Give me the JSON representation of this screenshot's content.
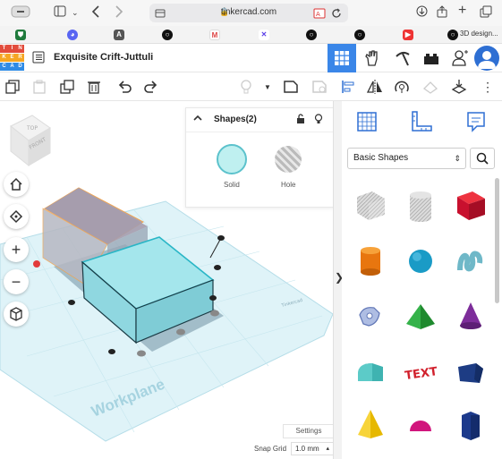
{
  "browser": {
    "url": "tinkercad.com",
    "bookmarks": [
      {
        "icon": "shield-icon"
      },
      {
        "icon": "discord-icon"
      },
      {
        "icon": "a-icon"
      },
      {
        "icon": "circle-icon"
      },
      {
        "icon": "gmail-icon"
      },
      {
        "icon": "x-icon"
      },
      {
        "icon": "circle-icon"
      },
      {
        "icon": "circle-icon"
      },
      {
        "icon": "youtube-icon"
      },
      {
        "icon": "circle-icon"
      }
    ],
    "last_bookmark_label": "3D design..."
  },
  "app": {
    "logo_letters": [
      "TIN",
      "KER",
      "CAD"
    ],
    "project_title": "Exquisite Crift-Juttuli",
    "colors": {
      "accent": "#3a86e8",
      "header_active": "#3a86e8",
      "solid": "#bff0f0",
      "solid_border": "#5cc2cc"
    }
  },
  "shapes_panel": {
    "title": "Shapes(2)",
    "solid_label": "Solid",
    "hole_label": "Hole"
  },
  "workspace": {
    "plane_label": "Workplane",
    "settings_label": "Settings",
    "snap_grid_label": "Snap Grid",
    "snap_grid_value": "1.0 mm",
    "viewcube": {
      "top": "TOP",
      "front": "FRONT"
    },
    "corner_note": "Tinkercad"
  },
  "library": {
    "selected_category": "Basic Shapes",
    "shapes": [
      {
        "name": "box-hole",
        "icon": "box-hole-icon"
      },
      {
        "name": "cylinder-hole",
        "icon": "cylinder-hole-icon"
      },
      {
        "name": "box",
        "icon": "box-icon"
      },
      {
        "name": "cylinder",
        "icon": "cylinder-icon"
      },
      {
        "name": "sphere",
        "icon": "sphere-icon"
      },
      {
        "name": "scribble",
        "icon": "scribble-icon"
      },
      {
        "name": "shape-generator",
        "icon": "shape-generator-icon"
      },
      {
        "name": "roof",
        "icon": "roof-icon"
      },
      {
        "name": "cone",
        "icon": "cone-icon"
      },
      {
        "name": "round-roof",
        "icon": "round-roof-icon"
      },
      {
        "name": "text",
        "icon": "text-icon",
        "text": "TEXT"
      },
      {
        "name": "polygon",
        "icon": "polygon-icon"
      },
      {
        "name": "pyramid",
        "icon": "pyramid-icon"
      },
      {
        "name": "half-sphere",
        "icon": "half-sphere-icon"
      },
      {
        "name": "hexagonal-prism",
        "icon": "hexagonal-prism-icon"
      }
    ]
  }
}
